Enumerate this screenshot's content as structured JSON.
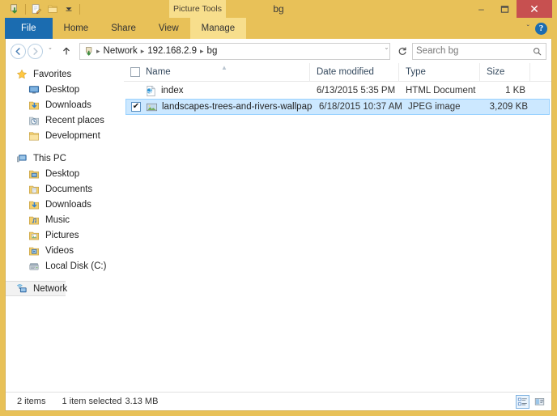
{
  "window": {
    "title": "bg",
    "frame_color": "#E8C158",
    "accent_blue": "#1B6CB0",
    "close_red": "#C75050",
    "minimize_label": "–",
    "maximize_label": "☐",
    "close_label": "✕"
  },
  "quick_access": {
    "items": [
      {
        "name": "properties-icon",
        "label": ""
      },
      {
        "name": "new-folder-icon",
        "label": ""
      },
      {
        "name": "folder-icon",
        "label": ""
      },
      {
        "name": "customize-qat-icon",
        "label": "▼"
      }
    ]
  },
  "ribbon": {
    "contextual_group": "Picture Tools",
    "tabs": [
      {
        "label": "File",
        "type": "file",
        "selected": false
      },
      {
        "label": "Home",
        "type": "normal",
        "selected": false
      },
      {
        "label": "Share",
        "type": "normal",
        "selected": false
      },
      {
        "label": "View",
        "type": "normal",
        "selected": false
      },
      {
        "label": "Manage",
        "type": "contextual",
        "selected": false
      }
    ],
    "collapse_label": "ˇ",
    "help_label": "?"
  },
  "address": {
    "back_label": "←",
    "forward_label": "→",
    "history_label": "ˇ",
    "up_label": "↑",
    "breadcrumbs": [
      "Network",
      "192.168.2.9",
      "bg"
    ],
    "separator": "▸",
    "dropdown_label": "ˇ",
    "refresh_label": "↻"
  },
  "search": {
    "placeholder": "Search bg",
    "icon": "search-icon"
  },
  "sidebar": {
    "groups": [
      {
        "header": {
          "label": "Favorites",
          "icon": "star-icon"
        },
        "items": [
          {
            "label": "Desktop",
            "icon": "desktop-icon"
          },
          {
            "label": "Downloads",
            "icon": "downloads-icon"
          },
          {
            "label": "Recent places",
            "icon": "recent-places-icon"
          },
          {
            "label": "Development",
            "icon": "folder-icon"
          }
        ]
      },
      {
        "header": {
          "label": "This PC",
          "icon": "computer-icon"
        },
        "items": [
          {
            "label": "Desktop",
            "icon": "desktop-folder-icon"
          },
          {
            "label": "Documents",
            "icon": "documents-icon"
          },
          {
            "label": "Downloads",
            "icon": "downloads-icon"
          },
          {
            "label": "Music",
            "icon": "music-icon"
          },
          {
            "label": "Pictures",
            "icon": "pictures-icon"
          },
          {
            "label": "Videos",
            "icon": "videos-icon"
          },
          {
            "label": "Local Disk (C:)",
            "icon": "hard-disk-icon"
          }
        ]
      },
      {
        "header": {
          "label": "Network",
          "icon": "network-icon",
          "selected": true
        },
        "items": []
      }
    ]
  },
  "filelist": {
    "columns": [
      {
        "label": "Name",
        "key": "name"
      },
      {
        "label": "Date modified",
        "key": "date"
      },
      {
        "label": "Type",
        "key": "type"
      },
      {
        "label": "Size",
        "key": "size"
      }
    ],
    "sort_column": "Name",
    "sort_direction": "ascending",
    "sort_caret": "▲",
    "rows": [
      {
        "name": "index",
        "date": "6/13/2015 5:35 PM",
        "type": "HTML Document",
        "size": "1 KB",
        "icon": "html-document-icon",
        "selected": false,
        "checked": false
      },
      {
        "name": "landscapes-trees-and-rivers-wallpaper",
        "date": "6/18/2015 10:37 AM",
        "type": "JPEG image",
        "size": "3,209 KB",
        "icon": "jpeg-image-icon",
        "selected": true,
        "checked": true,
        "check_mark": "✔"
      }
    ]
  },
  "statusbar": {
    "item_count": "2 items",
    "selection": "1 item selected",
    "selection_size": "3.13 MB",
    "views": [
      {
        "name": "details-view-button",
        "active": true
      },
      {
        "name": "large-icons-view-button",
        "active": false
      }
    ]
  }
}
